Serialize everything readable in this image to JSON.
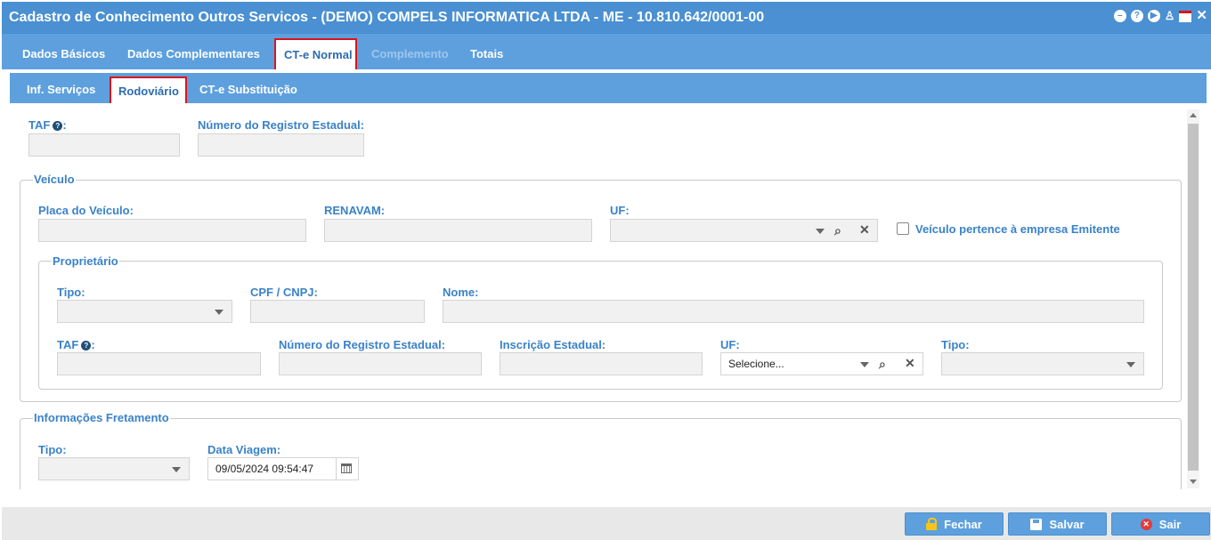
{
  "window": {
    "title": "Cadastro de Conhecimento Outros Servicos - (DEMO) COMPELS INFORMATICA LTDA - ME - 10.810.642/0001-00",
    "icons": [
      "minus-circle-icon",
      "help-circle-icon",
      "play-circle-icon",
      "bell-icon",
      "calendar-icon",
      "close-icon"
    ]
  },
  "tabs_main": [
    {
      "label": "Dados Básicos"
    },
    {
      "label": "Dados Complementares"
    },
    {
      "label": "CT-e Normal",
      "active": true
    },
    {
      "label": "Complemento",
      "disabled": true
    },
    {
      "label": "Totais"
    }
  ],
  "tabs_sub": [
    {
      "label": "Inf. Serviços"
    },
    {
      "label": "Rodoviário",
      "active": true
    },
    {
      "label": "CT-e Substituição"
    }
  ],
  "form": {
    "taf_label": "TAF",
    "taf_suffix": ":",
    "taf_value": "",
    "registro_label": "Número do Registro Estadual:",
    "registro_value": ""
  },
  "veiculo": {
    "legend": "Veículo",
    "placa_label": "Placa do Veículo:",
    "placa_value": "",
    "renavam_label": "RENAVAM:",
    "renavam_value": "",
    "uf_label": "UF:",
    "uf_value": "",
    "emitente_label": "Veículo pertence à empresa Emitente",
    "emitente_checked": false
  },
  "proprietario": {
    "legend": "Proprietário",
    "tipo_label": "Tipo:",
    "tipo_value": "",
    "cpf_label": "CPF / CNPJ:",
    "cpf_value": "",
    "nome_label": "Nome:",
    "nome_value": "",
    "taf_label": "TAF",
    "taf_suffix": ":",
    "taf_value": "",
    "registro_label": "Número do Registro Estadual:",
    "registro_value": "",
    "ie_label": "Inscrição Estadual:",
    "ie_value": "",
    "uf_label": "UF:",
    "uf_placeholder": "Selecione...",
    "tipo2_label": "Tipo:",
    "tipo2_value": ""
  },
  "fretamento": {
    "legend": "Informações Fretamento",
    "tipo_label": "Tipo:",
    "tipo_value": "",
    "data_label": "Data Viagem:",
    "data_value": "09/05/2024 09:54:47"
  },
  "footer": {
    "fechar": "Fechar",
    "salvar": "Salvar",
    "sair": "Sair"
  },
  "colors": {
    "title_bar": "#4a90d2",
    "tab_bar": "#5ea0de",
    "label_blue": "#3a82c8",
    "active_outline": "#d9151d"
  }
}
